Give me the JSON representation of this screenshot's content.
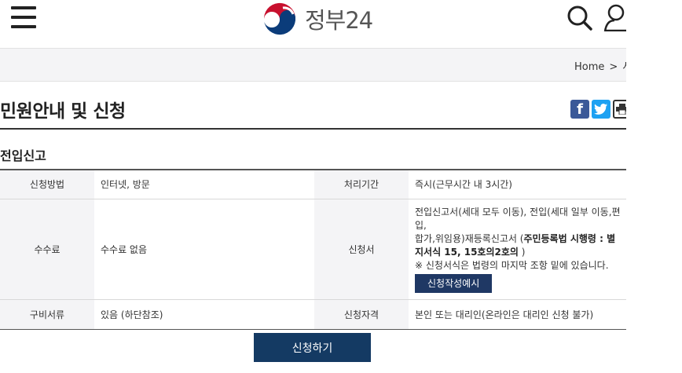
{
  "header": {
    "menu_icon": "hamburger-menu-icon",
    "logo_text": "정부24",
    "search_icon": "search-icon",
    "user_icon": "user-icon"
  },
  "breadcrumb": {
    "home": "Home",
    "separator": ">",
    "next_partial": "서"
  },
  "page": {
    "title": "민원안내 및 신청"
  },
  "share": {
    "facebook_label": "f",
    "twitter_icon": "twitter-bird-icon",
    "print_icon": "print-icon"
  },
  "section": {
    "title": "전입신고"
  },
  "info_table": {
    "rows": [
      {
        "label1": "신청방법",
        "value1": "인터넷, 방문",
        "label2": "처리기간",
        "value2": "즉시(근무시간 내 3시간)"
      },
      {
        "label1": "수수료",
        "value1": "수수료 없음",
        "label2": "신청서",
        "value2_line1": "전입신고서(세대 모두 이동), 전입(세대 일부 이동,편입,",
        "value2_line2": "합가,위임용)재등록신고서 (",
        "value2_bold": "주민등록법 시행령 : 별지서식 15, 15호의2호의",
        "value2_tail": " )",
        "value2_note": "※ 신청서식은 법령의 마지막 조항 밑에 있습니다.",
        "sample_button": "신청작성예시"
      },
      {
        "label1": "구비서류",
        "value1": "있음 (하단참조)",
        "label2": "신청자격",
        "value2": "본인 또는 대리인(온라인은 대리인 신청 불가)"
      }
    ]
  },
  "actions": {
    "apply_button": "신청하기"
  },
  "colors": {
    "navy": "#143a63",
    "sample_button": "#1f3864",
    "facebook": "#3b5998",
    "twitter": "#1da1f2",
    "logo_red": "#c8102e",
    "logo_blue": "#0b3c7a"
  }
}
